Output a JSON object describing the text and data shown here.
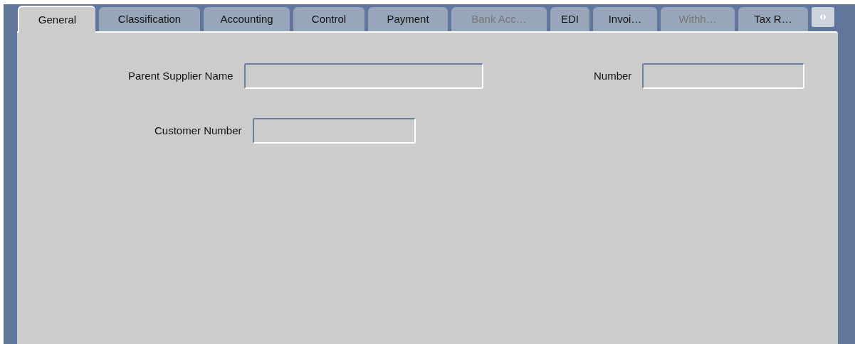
{
  "tabs": [
    {
      "label": "General",
      "selected": true,
      "disabled": false
    },
    {
      "label": "Classification",
      "selected": false,
      "disabled": false
    },
    {
      "label": "Accounting",
      "selected": false,
      "disabled": false
    },
    {
      "label": "Control",
      "selected": false,
      "disabled": false
    },
    {
      "label": "Payment",
      "selected": false,
      "disabled": false
    },
    {
      "label": "Bank Acc…",
      "selected": false,
      "disabled": true
    },
    {
      "label": "EDI",
      "selected": false,
      "disabled": false
    },
    {
      "label": "Invoi…",
      "selected": false,
      "disabled": false
    },
    {
      "label": "Withh…",
      "selected": false,
      "disabled": true
    },
    {
      "label": "Tax R…",
      "selected": false,
      "disabled": false
    }
  ],
  "fields": [
    {
      "label": "Parent Supplier Name"
    },
    {
      "label": "Number"
    },
    {
      "label": "Customer Number"
    }
  ]
}
